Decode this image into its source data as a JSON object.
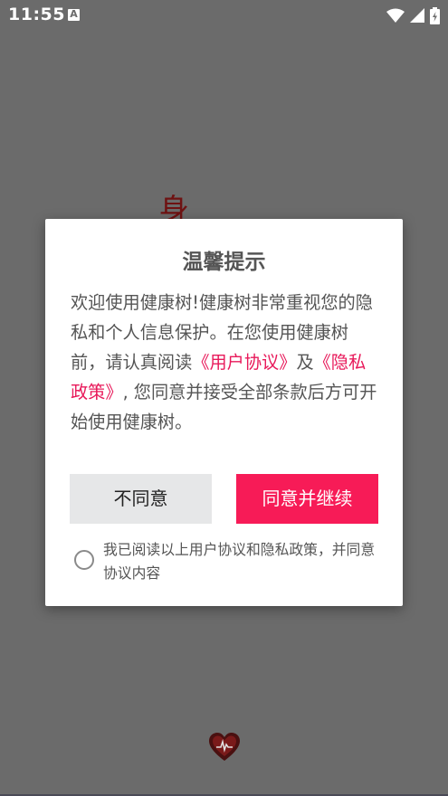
{
  "status_bar": {
    "time": "11:55",
    "notification_icon": "a-app-icon",
    "wifi_icon": "wifi-icon",
    "signal_icon": "signal-icon",
    "battery_icon": "battery-charging-icon"
  },
  "background": {
    "partial_text": "身",
    "logo_icon": "heart-logo-icon"
  },
  "dialog": {
    "title": "温馨提示",
    "body_intro": "欢迎使用健康树!健康树非常重视您的隐私和个人信息保护。在您使用健康树前，请认真阅读",
    "user_agreement_link": "《用户协议》",
    "and_text": "及",
    "privacy_policy_link": "《隐私政策》",
    "body_outro": ", 您同意并接受全部条款后方可开始使用健康树。",
    "decline_label": "不同意",
    "accept_label": "同意并继续",
    "agree_text": "我已阅读以上用户协议和隐私政策，并同意协议内容"
  },
  "colors": {
    "accent": "#f71b57",
    "link": "#e8195a",
    "overlay": "#6b6b6b",
    "decline_bg": "#e6e7e8"
  }
}
